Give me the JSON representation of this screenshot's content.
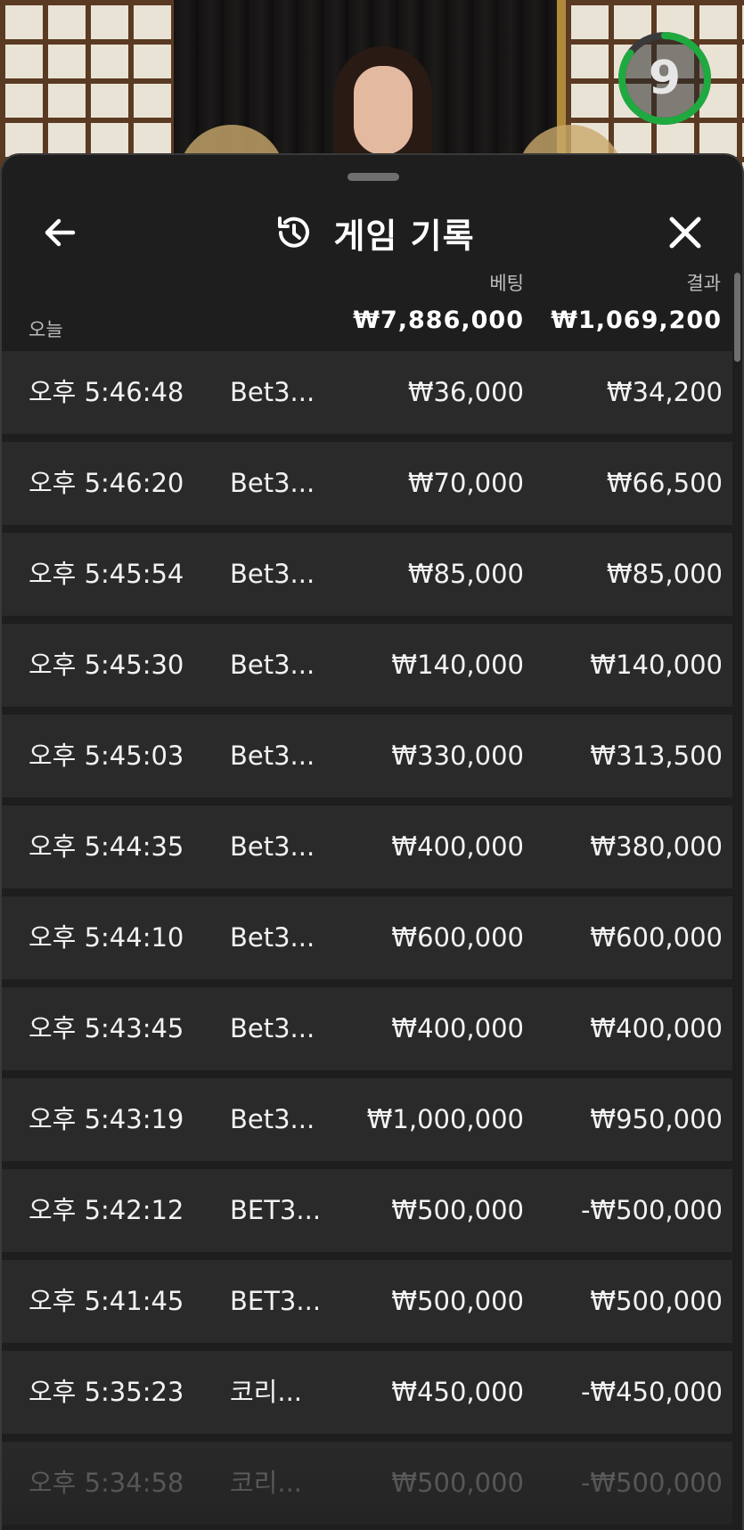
{
  "video": {
    "timer_value": "9",
    "timer_progress": 0.85,
    "timer_color": "#1faa3f"
  },
  "sheet": {
    "title": "게임 기록",
    "icons": {
      "back": "arrow-left-icon",
      "history": "history-clock-icon",
      "close": "close-icon"
    },
    "columns": {
      "bet_label": "베팅",
      "result_label": "결과"
    },
    "summary": {
      "date_label": "오늘",
      "total_bet": "₩7,886,000",
      "total_result": "₩1,069,200"
    },
    "rows": [
      {
        "time": "오후 5:46:48",
        "game": "Bet3...",
        "bet": "₩36,000",
        "result": "₩34,200"
      },
      {
        "time": "오후 5:46:20",
        "game": "Bet3...",
        "bet": "₩70,000",
        "result": "₩66,500"
      },
      {
        "time": "오후 5:45:54",
        "game": "Bet3...",
        "bet": "₩85,000",
        "result": "₩85,000"
      },
      {
        "time": "오후 5:45:30",
        "game": "Bet3...",
        "bet": "₩140,000",
        "result": "₩140,000"
      },
      {
        "time": "오후 5:45:03",
        "game": "Bet3...",
        "bet": "₩330,000",
        "result": "₩313,500"
      },
      {
        "time": "오후 5:44:35",
        "game": "Bet3...",
        "bet": "₩400,000",
        "result": "₩380,000"
      },
      {
        "time": "오후 5:44:10",
        "game": "Bet3...",
        "bet": "₩600,000",
        "result": "₩600,000"
      },
      {
        "time": "오후 5:43:45",
        "game": "Bet3...",
        "bet": "₩400,000",
        "result": "₩400,000"
      },
      {
        "time": "오후 5:43:19",
        "game": "Bet3...",
        "bet": "₩1,000,000",
        "result": "₩950,000"
      },
      {
        "time": "오후 5:42:12",
        "game": "BET3...",
        "bet": "₩500,000",
        "result": "-₩500,000"
      },
      {
        "time": "오후 5:41:45",
        "game": "BET3...",
        "bet": "₩500,000",
        "result": "₩500,000"
      },
      {
        "time": "오후 5:35:23",
        "game": "코리...",
        "bet": "₩450,000",
        "result": "-₩450,000"
      },
      {
        "time": "오후 5:34:58",
        "game": "코리...",
        "bet": "₩500,000",
        "result": "-₩500,000"
      }
    ]
  }
}
